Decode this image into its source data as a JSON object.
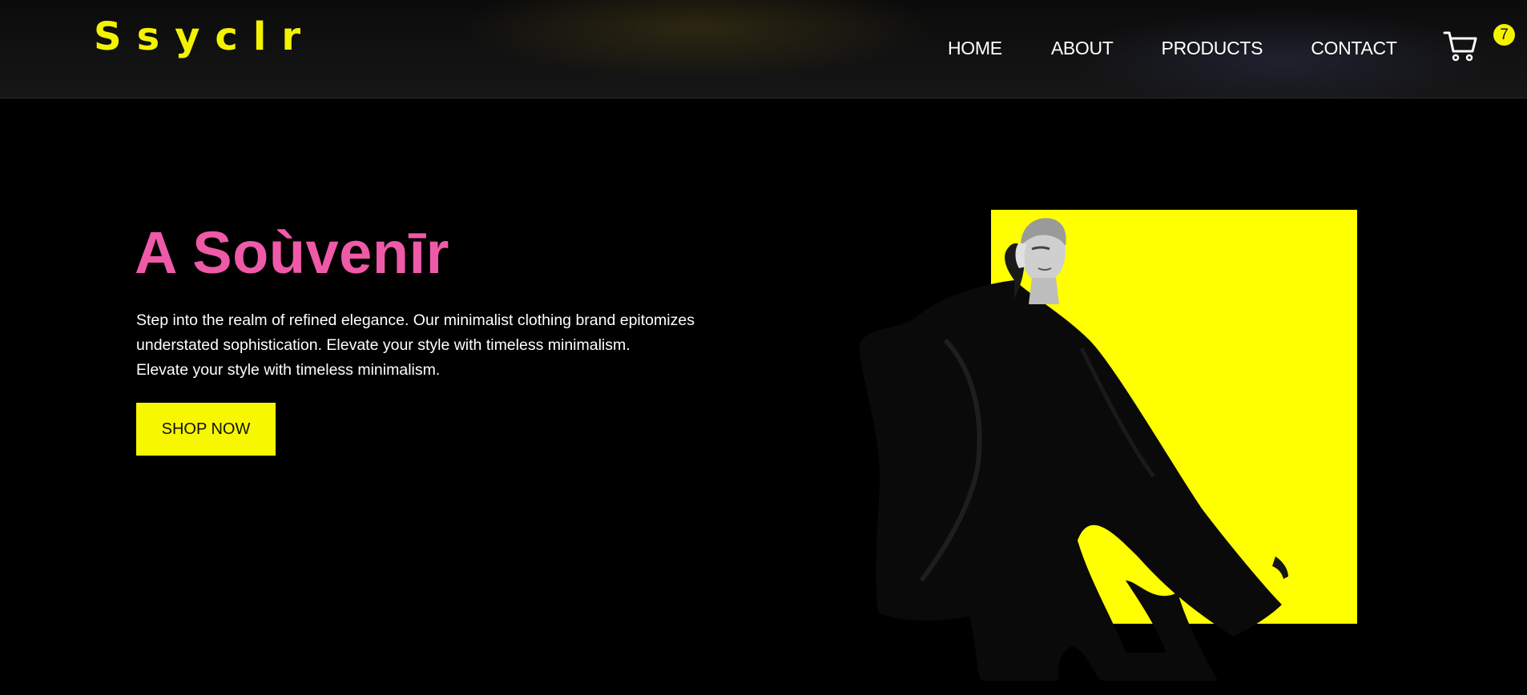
{
  "header": {
    "logo": "Ssyclr",
    "nav": {
      "home": "HOME",
      "about": "ABOUT",
      "products": "PRODUCTS",
      "contact": "CONTACT"
    },
    "cart": {
      "icon": "cart-icon",
      "count": "7"
    }
  },
  "hero": {
    "title": "A Soùvenīr",
    "description_lines": [
      "Step into the realm of refined elegance. Our minimalist clothing brand epitomizes",
      "understated sophistication. Elevate your style with timeless minimalism.",
      "Elevate your style with timeless minimalism."
    ],
    "cta_label": "SHOP NOW"
  },
  "colors": {
    "accent_yellow": "#ffff00",
    "title_pink": "#ef5aa8",
    "background": "#000000"
  }
}
